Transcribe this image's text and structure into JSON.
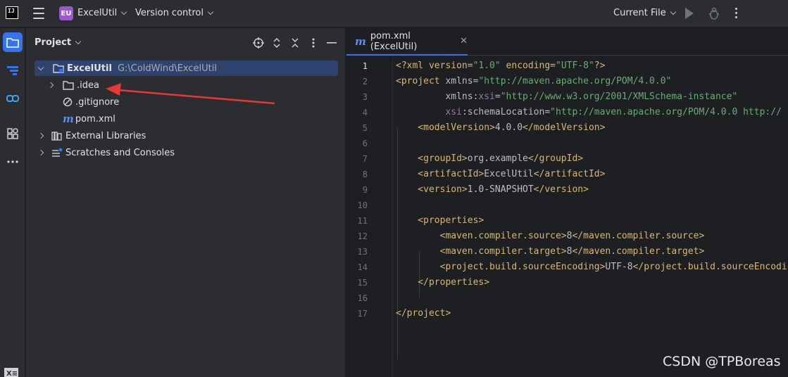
{
  "titlebar": {
    "logo_text": "IJ",
    "project_badge": "EU",
    "project_name": "ExcelUtil",
    "vcs_label": "Version control",
    "run_config": "Current File"
  },
  "sidebar_icons": [
    "folder-icon",
    "structure-icon",
    "bookmarks-icon",
    "plugins-icon",
    "more-icon"
  ],
  "project_pane": {
    "title": "Project",
    "tree": [
      {
        "label": "ExcelUtil",
        "path": "G:\\ColdWind\\ExcelUtil",
        "icon": "module-folder-icon",
        "expanded": true
      },
      {
        "label": ".idea",
        "icon": "folder-icon"
      },
      {
        "label": ".gitignore",
        "icon": "ignore-file-icon"
      },
      {
        "label": "pom.xml",
        "icon": "maven-icon"
      },
      {
        "label": "External Libraries",
        "icon": "library-icon"
      },
      {
        "label": "Scratches and Consoles",
        "icon": "scratches-icon"
      }
    ]
  },
  "editor": {
    "tab_label": "pom.xml (ExcelUtil)",
    "line_numbers": [
      "1",
      "2",
      "3",
      "4",
      "5",
      "6",
      "7",
      "8",
      "9",
      "10",
      "11",
      "12",
      "13",
      "14",
      "15",
      "16",
      "17"
    ],
    "code": {
      "l1_a": "<?xml version=",
      "l1_b": "\"1.0\"",
      "l1_c": " encoding=",
      "l1_d": "\"UTF-8\"",
      "l1_e": "?>",
      "l2_a": "<project ",
      "l2_b": "xmlns=",
      "l2_c": "\"http://maven.apache.org/POM/4.0.0\"",
      "l3_a": "         xmlns:",
      "l3_b": "xsi",
      "l3_c": "=",
      "l3_d": "\"http://www.w3.org/2001/XMLSchema-instance\"",
      "l4_a": "         ",
      "l4_b": "xsi",
      "l4_c": ":schemaLocation=",
      "l4_d": "\"http://maven.apache.org/POM/4.0.0 http://",
      "l5_a": "    <modelVersion>",
      "l5_b": "4.0.0",
      "l5_c": "</modelVersion>",
      "l7_a": "    <groupId>",
      "l7_b": "org.example",
      "l7_c": "</groupId>",
      "l8_a": "    <artifactId>",
      "l8_b": "ExcelUtil",
      "l8_c": "</artifactId>",
      "l9_a": "    <version>",
      "l9_b": "1.0-SNAPSHOT",
      "l9_c": "</version>",
      "l11": "    <properties>",
      "l12_a": "        <maven.compiler.source>",
      "l12_b": "8",
      "l12_c": "</maven.compiler.source>",
      "l13_a": "        <maven.compiler.target>",
      "l13_b": "8",
      "l13_c": "</maven.compiler.target>",
      "l14_a": "        <project.build.sourceEncoding>",
      "l14_b": "UTF-8",
      "l14_c": "</project.build.sourceEncoding>",
      "l15": "    </properties>",
      "l17": "</project>"
    }
  },
  "watermark": "CSDN @TPBoreas",
  "colors": {
    "accent": "#3574f0",
    "selection": "#2e436e",
    "tag": "#d5b778",
    "attr_value": "#6aab73",
    "namespace": "#9876aa",
    "annotation_arrow": "#e53935"
  }
}
